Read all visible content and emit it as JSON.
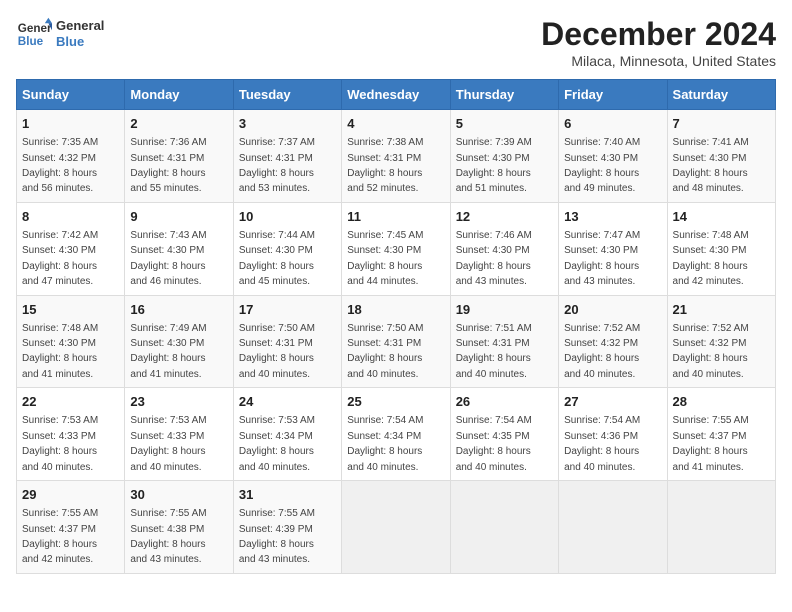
{
  "header": {
    "logo_line1": "General",
    "logo_line2": "Blue",
    "main_title": "December 2024",
    "subtitle": "Milaca, Minnesota, United States"
  },
  "calendar": {
    "days_of_week": [
      "Sunday",
      "Monday",
      "Tuesday",
      "Wednesday",
      "Thursday",
      "Friday",
      "Saturday"
    ],
    "weeks": [
      [
        {
          "day": "1",
          "sunrise": "7:35 AM",
          "sunset": "4:32 PM",
          "daylight": "8 hours and 56 minutes."
        },
        {
          "day": "2",
          "sunrise": "7:36 AM",
          "sunset": "4:31 PM",
          "daylight": "8 hours and 55 minutes."
        },
        {
          "day": "3",
          "sunrise": "7:37 AM",
          "sunset": "4:31 PM",
          "daylight": "8 hours and 53 minutes."
        },
        {
          "day": "4",
          "sunrise": "7:38 AM",
          "sunset": "4:31 PM",
          "daylight": "8 hours and 52 minutes."
        },
        {
          "day": "5",
          "sunrise": "7:39 AM",
          "sunset": "4:30 PM",
          "daylight": "8 hours and 51 minutes."
        },
        {
          "day": "6",
          "sunrise": "7:40 AM",
          "sunset": "4:30 PM",
          "daylight": "8 hours and 49 minutes."
        },
        {
          "day": "7",
          "sunrise": "7:41 AM",
          "sunset": "4:30 PM",
          "daylight": "8 hours and 48 minutes."
        }
      ],
      [
        {
          "day": "8",
          "sunrise": "7:42 AM",
          "sunset": "4:30 PM",
          "daylight": "8 hours and 47 minutes."
        },
        {
          "day": "9",
          "sunrise": "7:43 AM",
          "sunset": "4:30 PM",
          "daylight": "8 hours and 46 minutes."
        },
        {
          "day": "10",
          "sunrise": "7:44 AM",
          "sunset": "4:30 PM",
          "daylight": "8 hours and 45 minutes."
        },
        {
          "day": "11",
          "sunrise": "7:45 AM",
          "sunset": "4:30 PM",
          "daylight": "8 hours and 44 minutes."
        },
        {
          "day": "12",
          "sunrise": "7:46 AM",
          "sunset": "4:30 PM",
          "daylight": "8 hours and 43 minutes."
        },
        {
          "day": "13",
          "sunrise": "7:47 AM",
          "sunset": "4:30 PM",
          "daylight": "8 hours and 43 minutes."
        },
        {
          "day": "14",
          "sunrise": "7:48 AM",
          "sunset": "4:30 PM",
          "daylight": "8 hours and 42 minutes."
        }
      ],
      [
        {
          "day": "15",
          "sunrise": "7:48 AM",
          "sunset": "4:30 PM",
          "daylight": "8 hours and 41 minutes."
        },
        {
          "day": "16",
          "sunrise": "7:49 AM",
          "sunset": "4:30 PM",
          "daylight": "8 hours and 41 minutes."
        },
        {
          "day": "17",
          "sunrise": "7:50 AM",
          "sunset": "4:31 PM",
          "daylight": "8 hours and 40 minutes."
        },
        {
          "day": "18",
          "sunrise": "7:50 AM",
          "sunset": "4:31 PM",
          "daylight": "8 hours and 40 minutes."
        },
        {
          "day": "19",
          "sunrise": "7:51 AM",
          "sunset": "4:31 PM",
          "daylight": "8 hours and 40 minutes."
        },
        {
          "day": "20",
          "sunrise": "7:52 AM",
          "sunset": "4:32 PM",
          "daylight": "8 hours and 40 minutes."
        },
        {
          "day": "21",
          "sunrise": "7:52 AM",
          "sunset": "4:32 PM",
          "daylight": "8 hours and 40 minutes."
        }
      ],
      [
        {
          "day": "22",
          "sunrise": "7:53 AM",
          "sunset": "4:33 PM",
          "daylight": "8 hours and 40 minutes."
        },
        {
          "day": "23",
          "sunrise": "7:53 AM",
          "sunset": "4:33 PM",
          "daylight": "8 hours and 40 minutes."
        },
        {
          "day": "24",
          "sunrise": "7:53 AM",
          "sunset": "4:34 PM",
          "daylight": "8 hours and 40 minutes."
        },
        {
          "day": "25",
          "sunrise": "7:54 AM",
          "sunset": "4:34 PM",
          "daylight": "8 hours and 40 minutes."
        },
        {
          "day": "26",
          "sunrise": "7:54 AM",
          "sunset": "4:35 PM",
          "daylight": "8 hours and 40 minutes."
        },
        {
          "day": "27",
          "sunrise": "7:54 AM",
          "sunset": "4:36 PM",
          "daylight": "8 hours and 40 minutes."
        },
        {
          "day": "28",
          "sunrise": "7:55 AM",
          "sunset": "4:37 PM",
          "daylight": "8 hours and 41 minutes."
        }
      ],
      [
        {
          "day": "29",
          "sunrise": "7:55 AM",
          "sunset": "4:37 PM",
          "daylight": "8 hours and 42 minutes."
        },
        {
          "day": "30",
          "sunrise": "7:55 AM",
          "sunset": "4:38 PM",
          "daylight": "8 hours and 43 minutes."
        },
        {
          "day": "31",
          "sunrise": "7:55 AM",
          "sunset": "4:39 PM",
          "daylight": "8 hours and 43 minutes."
        },
        null,
        null,
        null,
        null
      ]
    ],
    "sunrise_label": "Sunrise:",
    "sunset_label": "Sunset:",
    "daylight_label": "Daylight:"
  }
}
